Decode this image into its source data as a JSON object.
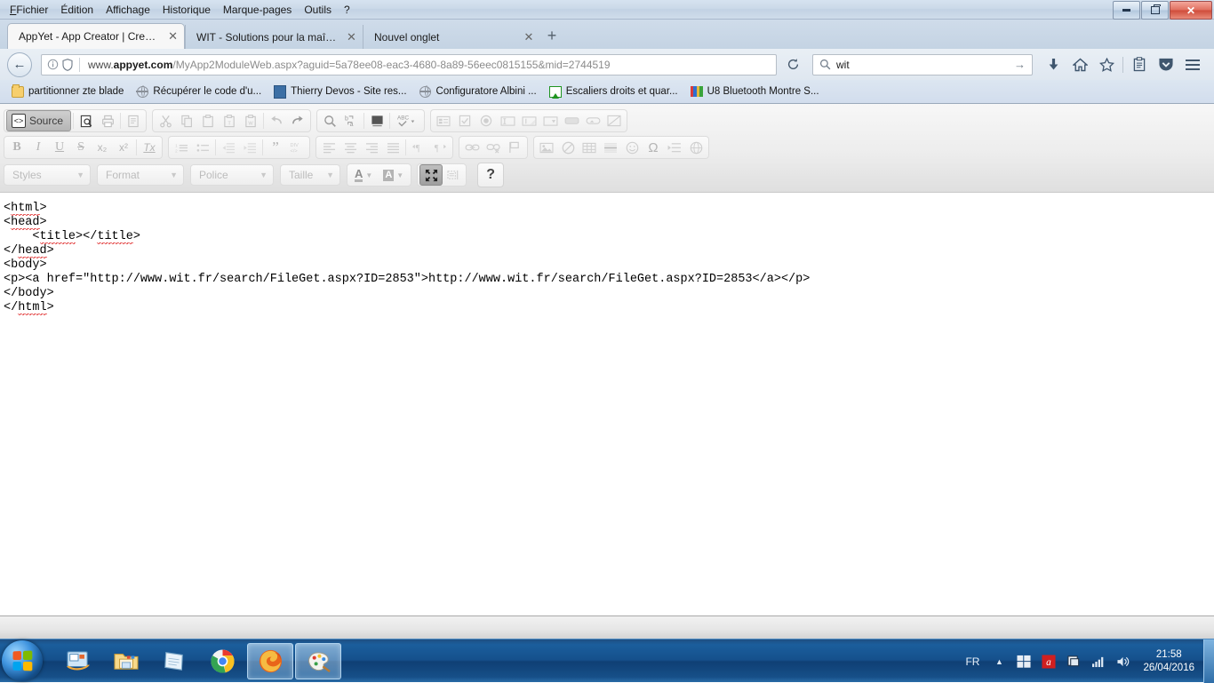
{
  "window": {
    "menus": [
      {
        "label": "Fichier",
        "mnemonic": "F"
      },
      {
        "label": "Édition",
        "mnemonic": "É"
      },
      {
        "label": "Affichage",
        "mnemonic": "A"
      },
      {
        "label": "Historique",
        "mnemonic": "H"
      },
      {
        "label": "Marque-pages",
        "mnemonic": "M"
      },
      {
        "label": "Outils",
        "mnemonic": "O"
      },
      {
        "label": "?",
        "mnemonic": "?"
      }
    ],
    "controls": {
      "minimize": "minimize-button",
      "restore": "restore-button",
      "close": "✕"
    }
  },
  "tabs": [
    {
      "label": "AppYet - App Creator | Create ...",
      "close": "✕",
      "active": true
    },
    {
      "label": "WIT - Solutions pour la maîtris...",
      "close": "✕",
      "active": false
    },
    {
      "label": "Nouvel onglet",
      "close": "✕",
      "active": false
    }
  ],
  "newtab_label": "+",
  "navigation": {
    "back_label": "←",
    "url_prefix": "www.",
    "url_host": "appyet.com",
    "url_path": "/MyApp2ModuleWeb.aspx?aguid=5a78ee08-eac3-4680-8a89-56eec0815155&mid=2744519",
    "reload_label": "⟳",
    "search_value": "wit",
    "search_go": "→",
    "icons": [
      "download-icon",
      "home-icon",
      "star-icon",
      "reader-icon",
      "pocket-icon",
      "menu-icon"
    ]
  },
  "bookmarks": [
    {
      "label": "partitionner zte blade",
      "icon": "folder-icon"
    },
    {
      "label": "Récupérer le code d'u...",
      "icon": "globe-icon"
    },
    {
      "label": "Thierry Devos - Site res...",
      "icon": "site-icon"
    },
    {
      "label": "Configuratore Albini ...",
      "icon": "globe-icon"
    },
    {
      "label": "Escaliers droits et quar...",
      "icon": "green-triangle-icon"
    },
    {
      "label": "U8 Bluetooth Montre S...",
      "icon": "color-bars-icon"
    }
  ],
  "editor": {
    "toolbar_row1": {
      "source_label": "Source",
      "group1": [
        "source-button"
      ],
      "group2": [
        "preview-icon",
        "print-icon",
        "templates-icon"
      ],
      "group3": [
        "cut-icon",
        "copy-icon",
        "paste-icon",
        "paste-text-icon",
        "paste-word-icon",
        "undo-icon",
        "redo-icon"
      ],
      "group4": [
        "find-icon",
        "replace-icon",
        "select-all-icon",
        "spellcheck-icon"
      ],
      "group5": [
        "form-icon",
        "checkbox-icon",
        "radio-icon",
        "textfield-icon",
        "textarea-icon",
        "select-icon",
        "button-icon",
        "imagebutton-icon",
        "hiddenfield-icon"
      ]
    },
    "toolbar_row2": {
      "group1": [
        "bold-icon",
        "italic-icon",
        "underline-icon",
        "strike-icon",
        "subscript-icon",
        "superscript-icon",
        "remove-format-icon"
      ],
      "group2": [
        "numbered-list-icon",
        "bulleted-list-icon",
        "outdent-icon",
        "indent-icon",
        "blockquote-icon",
        "div-icon"
      ],
      "group3": [
        "align-left-icon",
        "align-center-icon",
        "align-right-icon",
        "justify-icon",
        "ltr-icon",
        "rtl-icon"
      ],
      "group4": [
        "link-icon",
        "unlink-icon",
        "anchor-icon"
      ],
      "group5": [
        "image-icon",
        "flash-icon",
        "table-icon",
        "horizontal-rule-icon",
        "smiley-icon",
        "special-char-icon",
        "page-break-icon",
        "iframe-icon"
      ],
      "labels": {
        "bold": "B",
        "italic": "I",
        "underline": "U",
        "strike": "S",
        "subscript": "x₂",
        "superscript": "x²",
        "remove_format": "Tx",
        "blockquote": "”",
        "div": "DIV",
        "omega": "Ω"
      }
    },
    "toolbar_row3": {
      "styles": "Styles",
      "format": "Format",
      "police": "Police",
      "taille": "Taille",
      "text_color": "A",
      "bg_color": "A",
      "maximize": "maximize-icon",
      "show_blocks": "show-blocks-icon",
      "help": "?"
    }
  },
  "source_code": {
    "lines": [
      "<html>",
      "<head>",
      "    <title></title>",
      "</head>",
      "<body>",
      "<p><a href=\"http://www.wit.fr/search/FileGet.aspx?ID=2853\">http://www.wit.fr/search/FileGet.aspx?ID=2853</a></p>",
      "</body>",
      "</html>"
    ]
  },
  "taskbar": {
    "start": "windows-start-orb",
    "items": [
      {
        "name": "windows-live-mail-icon"
      },
      {
        "name": "file-explorer-icon"
      },
      {
        "name": "notepad-icon"
      },
      {
        "name": "google-chrome-icon"
      },
      {
        "name": "firefox-icon",
        "active": true
      },
      {
        "name": "paint-icon",
        "active": true
      }
    ],
    "tray": {
      "language": "FR",
      "show_hidden": "▲",
      "icons": [
        "windows-update-icon",
        "avira-icon",
        "network-flag-icon",
        "signal-icon",
        "volume-icon"
      ],
      "time": "21:58",
      "date": "26/04/2016"
    }
  },
  "colors": {
    "accent_blue": "#15508c",
    "tab_active_bg": "#f7f7f7",
    "toolbar_bg": "#ededed",
    "close_red": "#cf4c3a",
    "spellcheck_red": "#e03030",
    "avira_red": "#d01f1f"
  }
}
